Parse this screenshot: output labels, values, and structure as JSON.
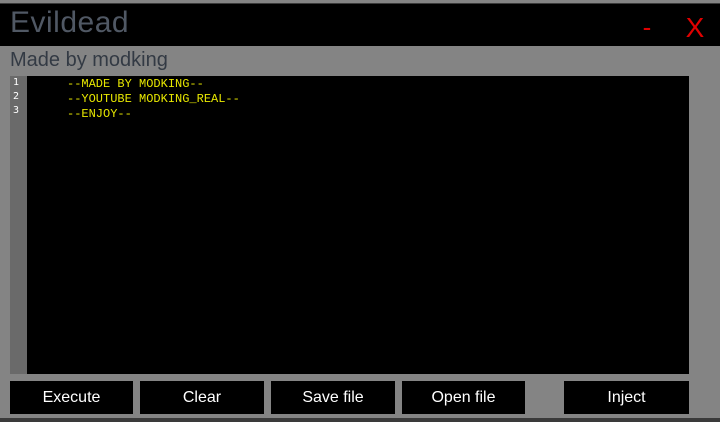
{
  "window": {
    "title": "Evildead",
    "subtitle": "Made by modking",
    "minimize_label": "-",
    "close_label": "X"
  },
  "editor": {
    "line_numbers": [
      "1",
      "2",
      "3"
    ],
    "lines": [
      "--MADE BY MODKING--",
      "--YOUTUBE MODKING_REAL--",
      "--ENJOY--"
    ],
    "text_color": "#e8e800",
    "background": "#000000"
  },
  "buttons": {
    "execute": "Execute",
    "clear": "Clear",
    "save_file": "Save file",
    "open_file": "Open file",
    "inject": "Inject"
  },
  "colors": {
    "accent_close": "#e00000",
    "window_bg": "#848484"
  }
}
